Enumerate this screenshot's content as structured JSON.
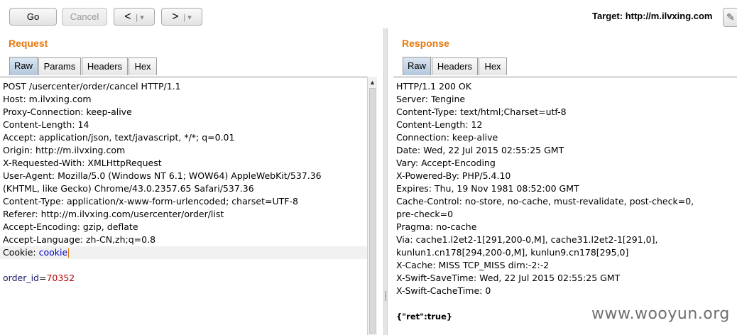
{
  "toolbar": {
    "go_label": "Go",
    "cancel_label": "Cancel",
    "back_glyph": "<",
    "forward_glyph": ">",
    "dropdown_glyph": "▾",
    "target_label": "Target: http://m.ilvxing.com",
    "edit_icon": "pencil-icon"
  },
  "request": {
    "title": "Request",
    "tabs": [
      "Raw",
      "Params",
      "Headers",
      "Hex"
    ],
    "active_tab": "Raw",
    "headers": [
      {
        "k": "POST /usercenter/order/cancel HTTP/1.1",
        "v": ""
      },
      {
        "k": "Host: ",
        "v": "m.ilvxing.com"
      },
      {
        "k": "Proxy-Connection: ",
        "v": "keep-alive"
      },
      {
        "k": "Content-Length: ",
        "v": "14"
      },
      {
        "k": "Accept: ",
        "v": "application/json, text/javascript, */*; q=0.01"
      },
      {
        "k": "Origin: ",
        "v": "http://m.ilvxing.com"
      },
      {
        "k": "X-Requested-With: ",
        "v": "XMLHttpRequest"
      },
      {
        "k": "User-Agent: ",
        "v": "Mozilla/5.0 (Windows NT 6.1; WOW64) AppleWebKit/537.36"
      },
      {
        "k": "(KHTML, like Gecko) Chrome/43.0.2357.65 Safari/537.36",
        "v": ""
      },
      {
        "k": "Content-Type: ",
        "v": "application/x-www-form-urlencoded; charset=UTF-8"
      },
      {
        "k": "Referer: ",
        "v": "http://m.ilvxing.com/usercenter/order/list"
      },
      {
        "k": "Accept-Encoding: ",
        "v": "gzip, deflate"
      },
      {
        "k": "Accept-Language: ",
        "v": "zh-CN,zh;q=0.8"
      }
    ],
    "cookie_key": "Cookie: ",
    "cookie_value": "cookie",
    "body_key": "order_id",
    "body_eq": "=",
    "body_value": "70352"
  },
  "response": {
    "title": "Response",
    "tabs": [
      "Raw",
      "Headers",
      "Hex"
    ],
    "active_tab": "Raw",
    "headers": [
      {
        "k": "HTTP/1.1 200 OK",
        "v": ""
      },
      {
        "k": "Server: ",
        "v": "Tengine"
      },
      {
        "k": "Content-Type: ",
        "v": "text/html;Charset=utf-8"
      },
      {
        "k": "Content-Length: ",
        "v": "12"
      },
      {
        "k": "Connection: ",
        "v": "keep-alive"
      },
      {
        "k": "Date: ",
        "v": "Wed, 22 Jul 2015 02:55:25 GMT"
      },
      {
        "k": "Vary: ",
        "v": "Accept-Encoding"
      },
      {
        "k": "X-Powered-By: ",
        "v": "PHP/5.4.10"
      },
      {
        "k": "Expires: ",
        "v": "Thu, 19 Nov 1981 08:52:00 GMT"
      },
      {
        "k": "Cache-Control: ",
        "v": "no-store, no-cache, must-revalidate, post-check=0,"
      },
      {
        "k": "pre-check=0",
        "v": ""
      },
      {
        "k": "Pragma: ",
        "v": "no-cache"
      },
      {
        "k": "Via: ",
        "v": "cache1.l2et2-1[291,200-0,M], cache31.l2et2-1[291,0],"
      },
      {
        "k": "kunlun1.cn178[294,200-0,M], kunlun9.cn178[295,0]",
        "v": ""
      },
      {
        "k": "X-Cache: ",
        "v": "MISS TCP_MISS dirn:-2:-2"
      },
      {
        "k": "X-Swift-SaveTime: ",
        "v": "Wed, 22 Jul 2015 02:55:25 GMT"
      },
      {
        "k": "X-Swift-CacheTime: ",
        "v": "0"
      }
    ],
    "body": "{\"ret\":true}"
  },
  "watermark": "www.wooyun.org"
}
